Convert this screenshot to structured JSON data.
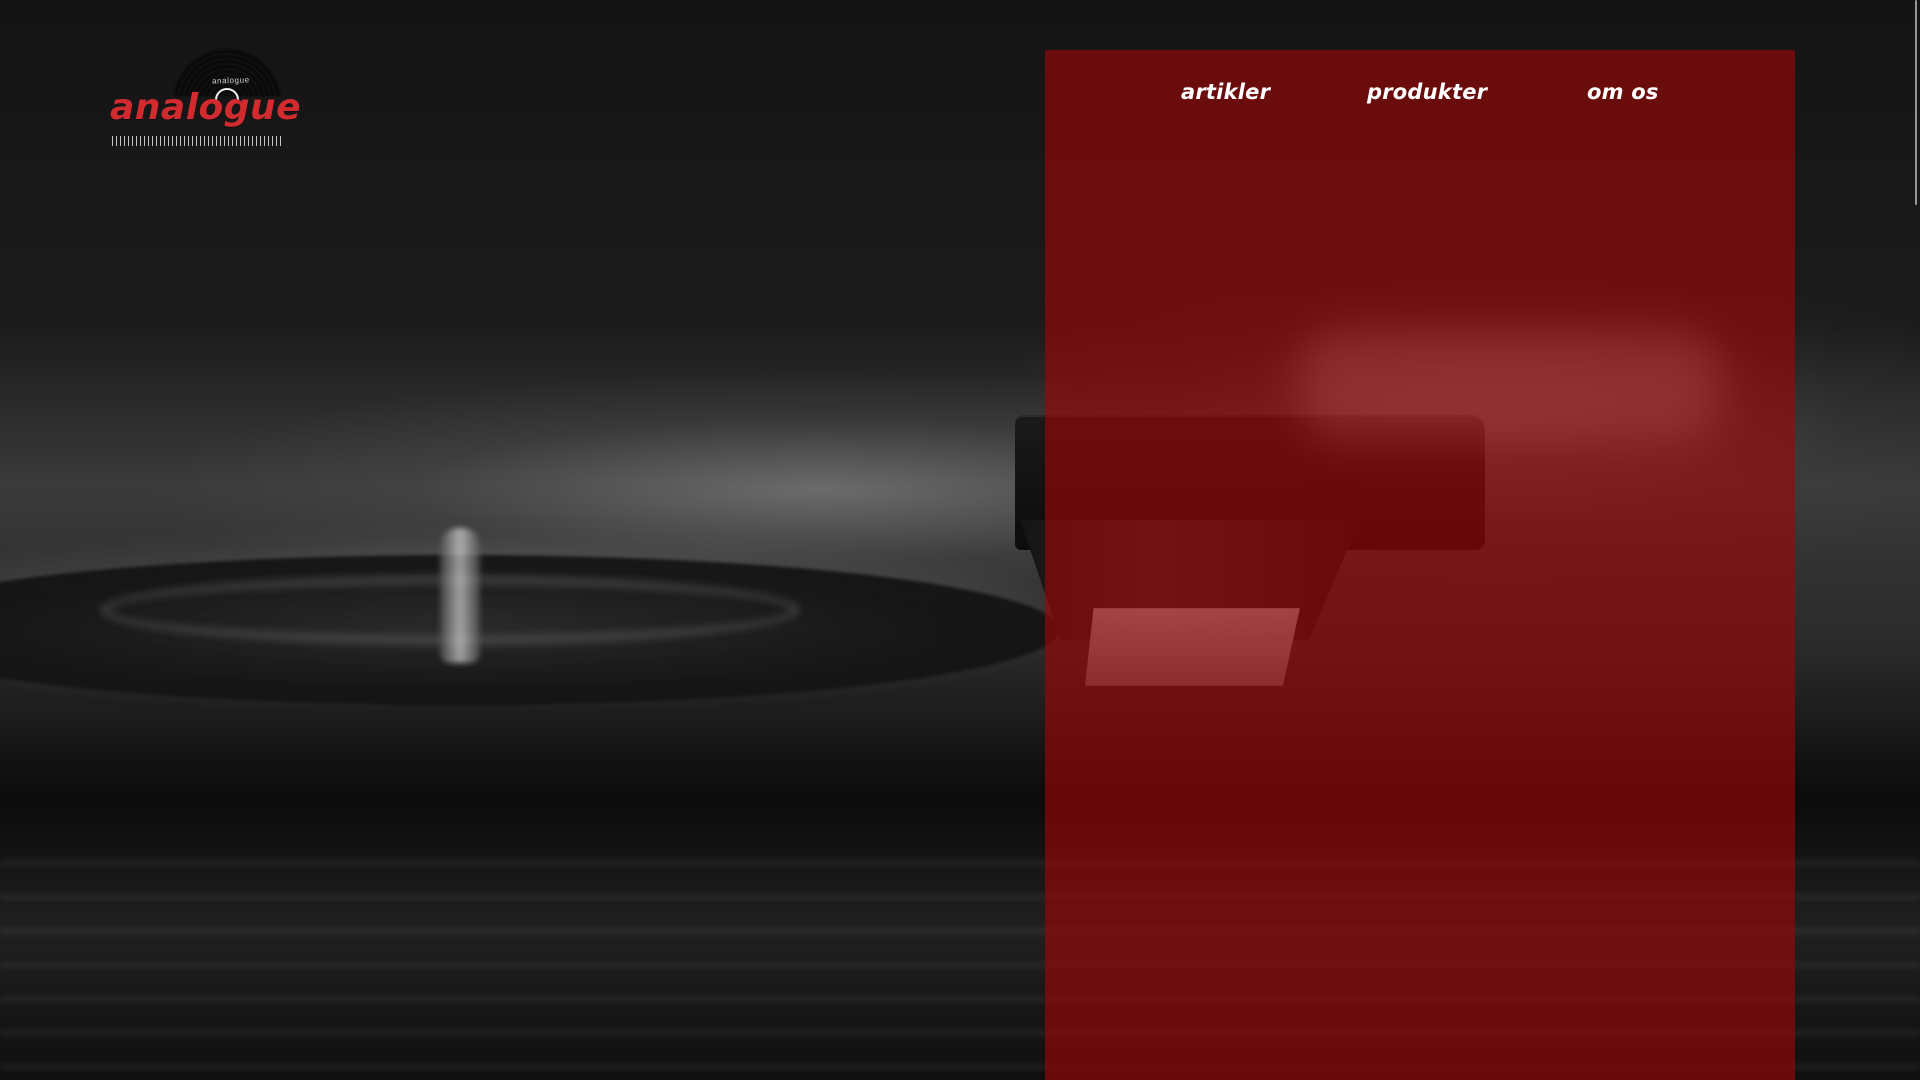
{
  "header": {
    "logo": {
      "wordmark": "analogue",
      "record_label_text": "analogue"
    },
    "nav": {
      "items": [
        {
          "label": "artikler"
        },
        {
          "label": "produkter"
        },
        {
          "label": "om os"
        }
      ]
    }
  },
  "hero": {
    "background_image": "turntable-photo",
    "overlay_color": "#A00606"
  },
  "colors": {
    "brand_red": "#D12B2F",
    "nav_text": "#FFFFFF"
  }
}
